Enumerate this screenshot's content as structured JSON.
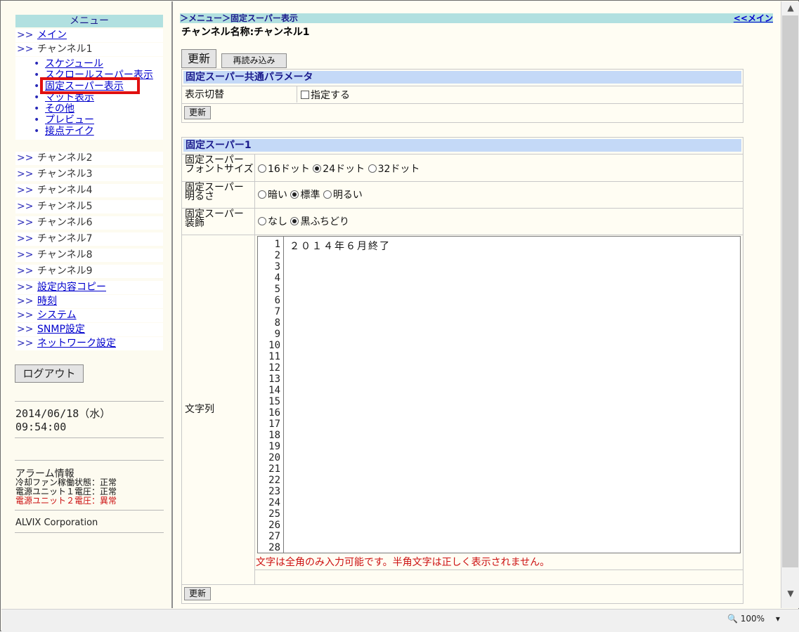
{
  "menu": {
    "header": "メニュー",
    "gt": ">>",
    "bullet": "•",
    "main": "メイン",
    "channel1": "チャンネル1",
    "sub_items": [
      "スケジュール",
      "スクロールスーパー表示",
      "固定スーパー表示",
      "マット表示",
      "その他",
      "プレビュー",
      "接点テイク"
    ],
    "channels": [
      "チャンネル2",
      "チャンネル3",
      "チャンネル4",
      "チャンネル5",
      "チャンネル6",
      "チャンネル7",
      "チャンネル8",
      "チャンネル9"
    ],
    "links": [
      "設定内容コピー",
      "時刻",
      "システム",
      "SNMP設定",
      "ネットワーク設定"
    ]
  },
  "logout_label": "ログアウト",
  "datetime": {
    "date": "2014/06/18（水）",
    "time": "09:54:00"
  },
  "alarm": {
    "title": "アラーム情報",
    "items": [
      {
        "text": "冷却ファン稼働状態：正常",
        "color": "#111111"
      },
      {
        "text": "電源ユニット１電圧：正常",
        "color": "#111111"
      },
      {
        "text": "電源ユニット２電圧：異常",
        "color": "#cc1010"
      }
    ]
  },
  "corp": "ALVIX Corporation",
  "breadcrumb": {
    "left": "＞メニュー＞固定スーパー表示",
    "right": "<<メイン"
  },
  "channel_title": "チャンネル名称:チャンネル1",
  "buttons": {
    "update": "更新",
    "reload": "再読み込み",
    "update_small": "更新"
  },
  "common": {
    "header": "固定スーパー共通パラメータ",
    "label": "表示切替",
    "checkbox": "指定する"
  },
  "super1": {
    "header": "固定スーパー1",
    "font_label": [
      "固定スーパー",
      "フォントサイズ"
    ],
    "font_opts": [
      {
        "label": "16ドット",
        "on": false
      },
      {
        "label": "24ドット",
        "on": true
      },
      {
        "label": "32ドット",
        "on": false
      }
    ],
    "bright_label": [
      "固定スーパー",
      "明るさ"
    ],
    "bright_opts": [
      {
        "label": "暗い",
        "on": false
      },
      {
        "label": "標準",
        "on": true
      },
      {
        "label": "明るい",
        "on": false
      }
    ],
    "deco_label": [
      "固定スーパー",
      "装飾"
    ],
    "deco_opts": [
      {
        "label": "なし",
        "on": false
      },
      {
        "label": "黒ふちどり",
        "on": true
      }
    ],
    "text_label": "文字列",
    "line_numbers": [
      "1",
      "2",
      "3",
      "4",
      "5",
      "6",
      "7",
      "8",
      "9",
      "10",
      "11",
      "12",
      "13",
      "14",
      "15",
      "16",
      "17",
      "18",
      "19",
      "20",
      "21",
      "22",
      "23",
      "24",
      "25",
      "26",
      "27",
      "28"
    ],
    "line1": "２０１４年６月終了",
    "warning": "文字は全角のみ入力可能です。半角文字は正しく表示されません。"
  },
  "zoom": "100%"
}
